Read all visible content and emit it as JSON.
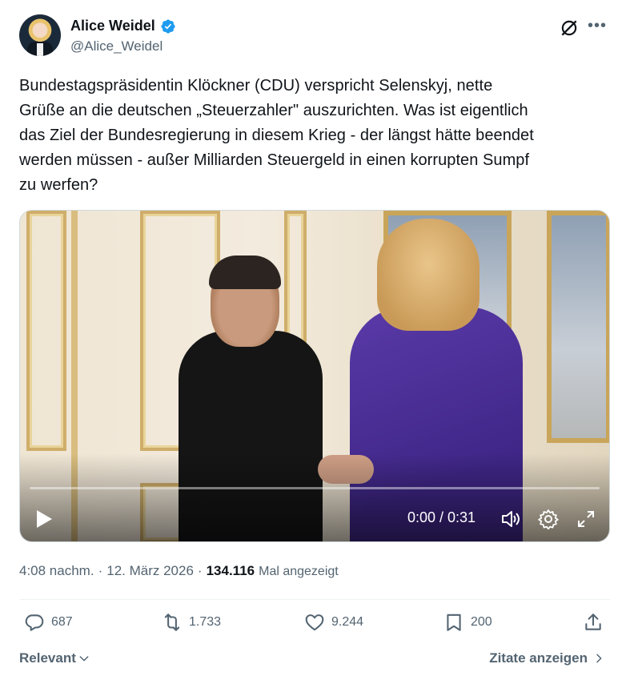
{
  "author": {
    "display_name": "Alice Weidel",
    "handle": "@Alice_Weidel",
    "verified_color": "#1d9bf0"
  },
  "tweet": {
    "text": "Bundestagspräsidentin Klöckner (CDU) verspricht Selenskyj, nette\nGrüße an die deutschen „Steuerzahler\" auszurichten. Was ist eigentlich\ndas Ziel der Bundesregierung in diesem Krieg - der längst hätte beendet\nwerden müssen - außer Milliarden Steuergeld  in einen korrupten Sumpf\nzu werfen?"
  },
  "video": {
    "time_display": "0:00 / 0:31",
    "progress": 0.0,
    "controls": [
      "play-icon",
      "volume-icon",
      "settings-icon",
      "fullscreen-icon"
    ]
  },
  "meta": {
    "time": "4:08 nachm.",
    "separator": "·",
    "date": "12. März 2026",
    "views": "134.116",
    "views_label": "Mal angezeigt"
  },
  "actions": {
    "replies": "687",
    "reposts": "1.733",
    "likes": "9.244",
    "bookmarks": "200"
  },
  "footer": {
    "sort_label": "Relevant",
    "quotes_label": "Zitate anzeigen"
  },
  "icons": {
    "verified": "verified-badge-icon",
    "grok": "grok-icon",
    "more": "more-icon",
    "reply": "reply-icon",
    "repost": "repost-icon",
    "like": "heart-icon",
    "bookmark": "bookmark-icon",
    "share": "share-icon"
  },
  "colors": {
    "text": "#0f1419",
    "secondary": "#536471",
    "divider": "#eff3f4"
  }
}
